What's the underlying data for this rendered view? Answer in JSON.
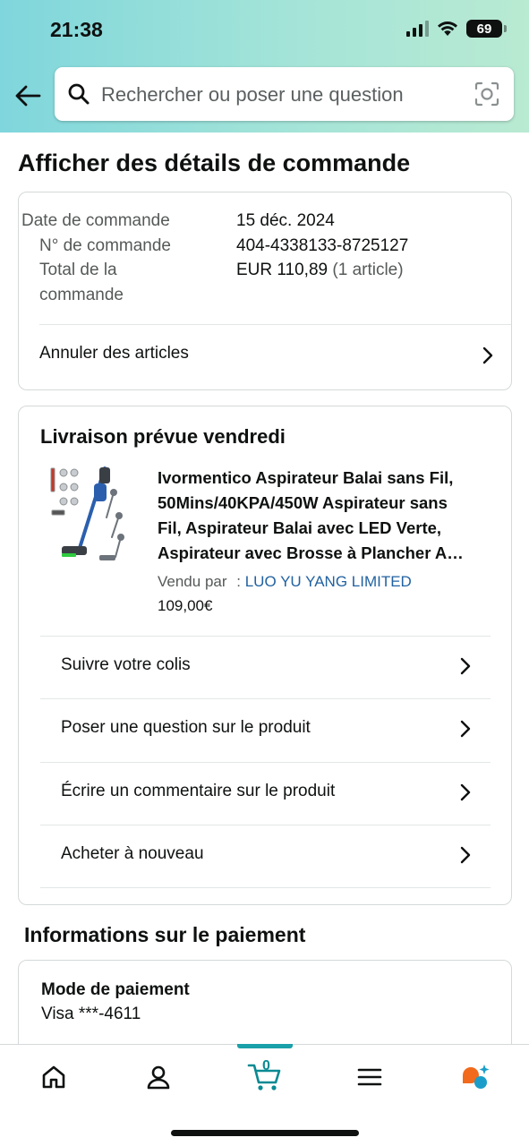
{
  "status_bar": {
    "time": "21:38",
    "battery": "69"
  },
  "search": {
    "placeholder": "Rechercher ou poser une question"
  },
  "page_title": "Afficher des détails de commande",
  "order_summary": {
    "rows": [
      {
        "label": "Date de commande",
        "value": "15 déc. 2024"
      },
      {
        "label": "N° de commande",
        "value": "404-4338133-8725127"
      },
      {
        "label_line1": "Total de la",
        "label_line2": "commande",
        "value": "EUR 110,89",
        "note": "(1 article)"
      }
    ],
    "cancel_label": "Annuler des articles"
  },
  "delivery": {
    "title": "Livraison prévue vendredi",
    "product": {
      "title_lines": [
        "Ivormentico Aspirateur Balai sans Fil,",
        "50Mins/40KPA/450W Aspirateur sans",
        "Fil, Aspirateur Balai avec LED Verte,",
        "Aspirateur avec Brosse à Plancher A…"
      ],
      "sold_by_label": "Vendu par",
      "sold_by_sep": ":",
      "seller": "LUO YU YANG LIMITED",
      "price": "109,00€"
    },
    "actions": [
      "Suivre votre colis",
      "Poser une question sur le produit",
      "Écrire un commentaire sur le produit",
      "Acheter à nouveau"
    ]
  },
  "payment": {
    "title": "Informations sur le paiement",
    "method_label": "Mode de paiement",
    "method_value": "Visa  ***-4611"
  },
  "tab_bar": {
    "active": "cart",
    "cart_count": "0",
    "tabs": [
      "home-icon",
      "account-icon",
      "cart-icon",
      "menu-icon",
      "rufus-icon"
    ]
  },
  "colors": {
    "accent": "#1aa0a8",
    "link": "#2162a1",
    "header_start": "#7fd6dc",
    "header_end": "#b9ead2"
  }
}
